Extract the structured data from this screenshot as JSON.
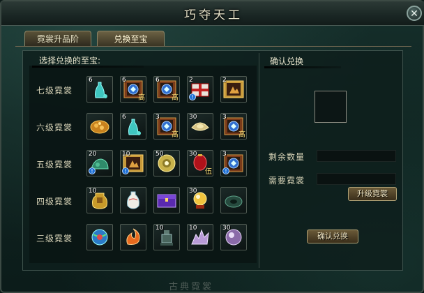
{
  "window": {
    "title": "巧夺天工",
    "close_icon": "close-icon"
  },
  "tabs": [
    {
      "label": "霓裳升品阶",
      "active": false
    },
    {
      "label": "兑换至宝",
      "active": true
    }
  ],
  "left": {
    "heading": "选择兑换的至宝:",
    "rows": [
      {
        "label": "七级霓裳",
        "items": [
          {
            "count": "6",
            "icon": "jade-vase-icon",
            "tag": "",
            "warn": false
          },
          {
            "count": "6",
            "icon": "scroll-icon",
            "tag": "高",
            "warn": false
          },
          {
            "count": "6",
            "icon": "scroll-icon",
            "tag": "高",
            "warn": false
          },
          {
            "count": "2",
            "icon": "gift-box-icon",
            "tag": "",
            "warn": true
          },
          {
            "count": "2",
            "icon": "framed-scroll-icon",
            "tag": "",
            "warn": false
          }
        ]
      },
      {
        "label": "六级霓裳",
        "items": [
          {
            "count": "",
            "icon": "gold-ore-icon",
            "tag": "",
            "warn": false
          },
          {
            "count": "6",
            "icon": "jade-vase-icon",
            "tag": "",
            "warn": false
          },
          {
            "count": "3",
            "icon": "scroll-icon",
            "tag": "高",
            "warn": false
          },
          {
            "count": "30",
            "icon": "gold-ingot-icon",
            "tag": "",
            "warn": false
          },
          {
            "count": "3",
            "icon": "scroll-icon",
            "tag": "高",
            "warn": false
          }
        ]
      },
      {
        "label": "五级霓裳",
        "items": [
          {
            "count": "20",
            "icon": "jade-stone-icon",
            "tag": "",
            "warn": true
          },
          {
            "count": "10",
            "icon": "framed-scroll-icon",
            "tag": "",
            "warn": true
          },
          {
            "count": "50",
            "icon": "gold-coin-icon",
            "tag": "",
            "warn": false
          },
          {
            "count": "30",
            "icon": "red-lantern-icon",
            "tag": "伍",
            "warn": false
          },
          {
            "count": "3",
            "icon": "scroll-icon",
            "tag": "",
            "warn": true
          }
        ]
      },
      {
        "label": "四级霓裳",
        "items": [
          {
            "count": "10",
            "icon": "golden-urn-icon",
            "tag": "",
            "warn": false
          },
          {
            "count": "",
            "icon": "porcelain-vase-icon",
            "tag": "",
            "warn": false
          },
          {
            "count": "",
            "icon": "purple-chest-icon",
            "tag": "",
            "warn": false
          },
          {
            "count": "30",
            "icon": "golden-orb-icon",
            "tag": "",
            "warn": false
          },
          {
            "count": "",
            "icon": "jade-disc-icon",
            "tag": "",
            "warn": false
          }
        ]
      },
      {
        "label": "三级霓裳",
        "items": [
          {
            "count": "",
            "icon": "magic-globe-icon",
            "tag": "",
            "warn": false
          },
          {
            "count": "",
            "icon": "flame-swirl-icon",
            "tag": "",
            "warn": false
          },
          {
            "count": "10",
            "icon": "bronze-figure-icon",
            "tag": "",
            "warn": false
          },
          {
            "count": "10",
            "icon": "crystal-cluster-icon",
            "tag": "",
            "warn": false
          },
          {
            "count": "30",
            "icon": "pearl-orb-icon",
            "tag": "",
            "warn": false
          }
        ]
      }
    ]
  },
  "right": {
    "heading": "确认兑换",
    "remaining_label": "剩余数量",
    "remaining_value": "",
    "required_label": "需要霓裳",
    "required_value": "",
    "upgrade_button": "升级霓裳",
    "confirm_button": "确认兑换"
  },
  "footer": {
    "text": "古典霓裳"
  },
  "colors": {
    "accent_gold": "#ffe27a",
    "text": "#d6d2b6",
    "warn_blue": "#1c6fd6"
  }
}
